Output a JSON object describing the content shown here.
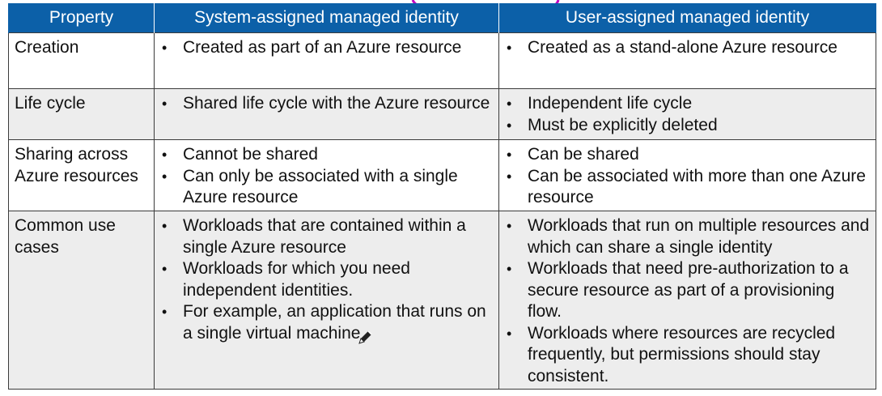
{
  "table": {
    "headers": [
      "Property",
      "System-assigned managed identity",
      "User-assigned managed identity"
    ],
    "rows": [
      {
        "property": "Creation",
        "system": [
          "Created as part of an Azure resource"
        ],
        "user": [
          "Created as a stand-alone Azure resource"
        ]
      },
      {
        "property": "Life cycle",
        "system": [
          "Shared life cycle with the Azure resource"
        ],
        "user": [
          "Independent life cycle",
          "Must be explicitly deleted"
        ]
      },
      {
        "property": "Sharing across Azure resources",
        "system": [
          "Cannot be shared",
          "Can only be associated with a single Azure resource"
        ],
        "user": [
          "Can be shared",
          "Can be associated with more than one Azure resource"
        ]
      },
      {
        "property": "Common use cases",
        "system": [
          "Workloads that are contained within a single Azure resource",
          "Workloads for which you need independent identities.",
          "For example, an application that runs on a single virtual machine"
        ],
        "user": [
          "Workloads that run on multiple resources and which can share a single identity",
          "Workloads that need pre-authorization to a secure resource as part of a provisioning flow.",
          "Workloads where resources are recycled frequently, but permissions should stay consistent."
        ]
      }
    ]
  },
  "colors": {
    "header_bg": "#0c60a8",
    "header_text": "#ffffff",
    "alt_row_bg": "#ededed",
    "annotation_ink": "#c000c0"
  },
  "icons": {
    "cursor": "pen-cursor-icon"
  }
}
